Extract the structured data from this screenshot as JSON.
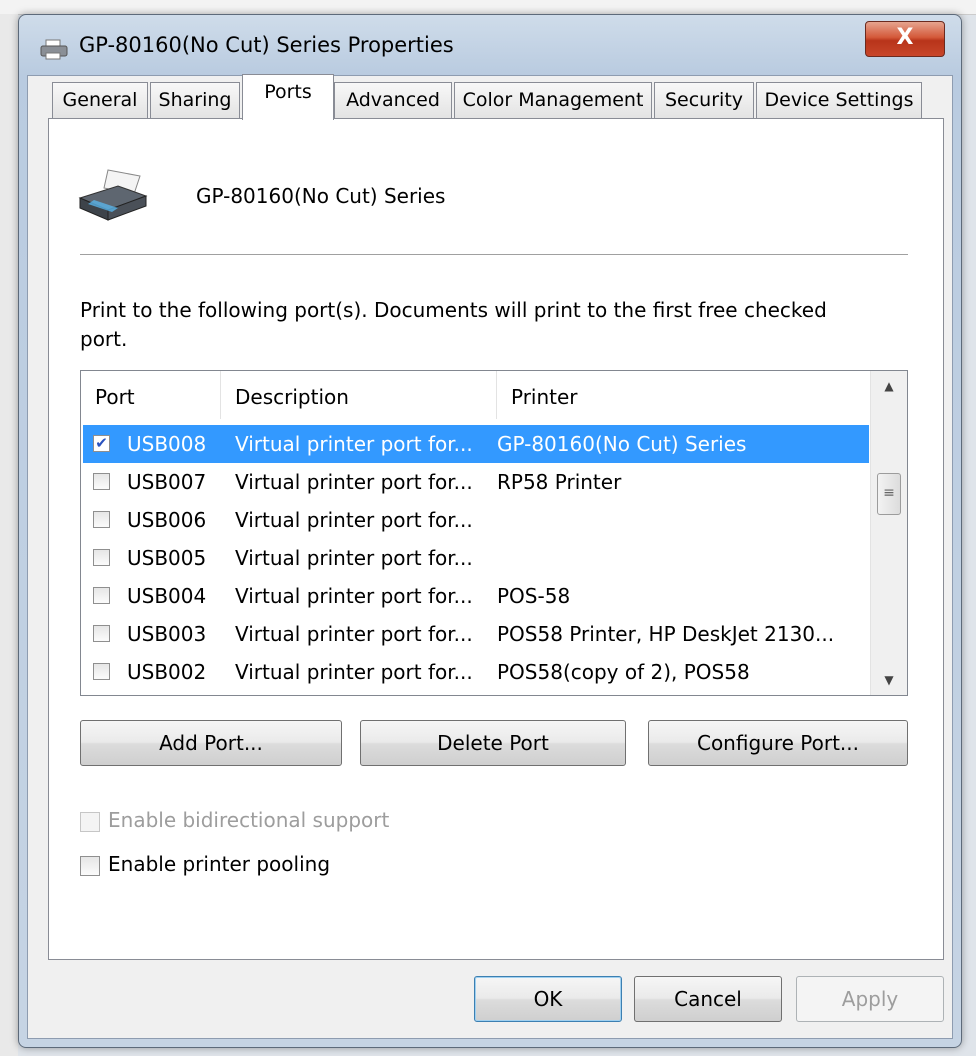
{
  "window": {
    "title": "GP-80160(No Cut) Series Properties",
    "close_label": "X"
  },
  "tabs": [
    {
      "label": "General",
      "active": false
    },
    {
      "label": "Sharing",
      "active": false
    },
    {
      "label": "Ports",
      "active": true
    },
    {
      "label": "Advanced",
      "active": false
    },
    {
      "label": "Color Management",
      "active": false
    },
    {
      "label": "Security",
      "active": false
    },
    {
      "label": "Device Settings",
      "active": false
    }
  ],
  "printer": {
    "name": "GP-80160(No Cut) Series",
    "icon": "printer-icon"
  },
  "instructions": "Print to the following port(s). Documents will print to the first free checked port.",
  "ports_table": {
    "columns": [
      "Port",
      "Description",
      "Printer"
    ],
    "rows": [
      {
        "checked": true,
        "selected": true,
        "port": "USB008",
        "description": "Virtual printer port for...",
        "printer": "GP-80160(No Cut) Series"
      },
      {
        "checked": false,
        "selected": false,
        "port": "USB007",
        "description": "Virtual printer port for...",
        "printer": "RP58 Printer"
      },
      {
        "checked": false,
        "selected": false,
        "port": "USB006",
        "description": "Virtual printer port for...",
        "printer": ""
      },
      {
        "checked": false,
        "selected": false,
        "port": "USB005",
        "description": "Virtual printer port for...",
        "printer": ""
      },
      {
        "checked": false,
        "selected": false,
        "port": "USB004",
        "description": "Virtual printer port for...",
        "printer": "POS-58"
      },
      {
        "checked": false,
        "selected": false,
        "port": "USB003",
        "description": "Virtual printer port for...",
        "printer": "POS58 Printer, HP DeskJet 2130..."
      },
      {
        "checked": false,
        "selected": false,
        "port": "USB002",
        "description": "Virtual printer port for...",
        "printer": "POS58(copy of 2), POS58"
      }
    ]
  },
  "port_buttons": {
    "add": "Add Port...",
    "delete": "Delete Port",
    "configure": "Configure Port..."
  },
  "options": {
    "bidirectional": {
      "label": "Enable bidirectional support",
      "checked": false,
      "enabled": false
    },
    "pooling": {
      "label": "Enable printer pooling",
      "checked": false,
      "enabled": true
    }
  },
  "dialog_buttons": {
    "ok": "OK",
    "cancel": "Cancel",
    "apply": "Apply"
  },
  "colors": {
    "selection": "#3399ff",
    "close_button": "#c8462a"
  }
}
